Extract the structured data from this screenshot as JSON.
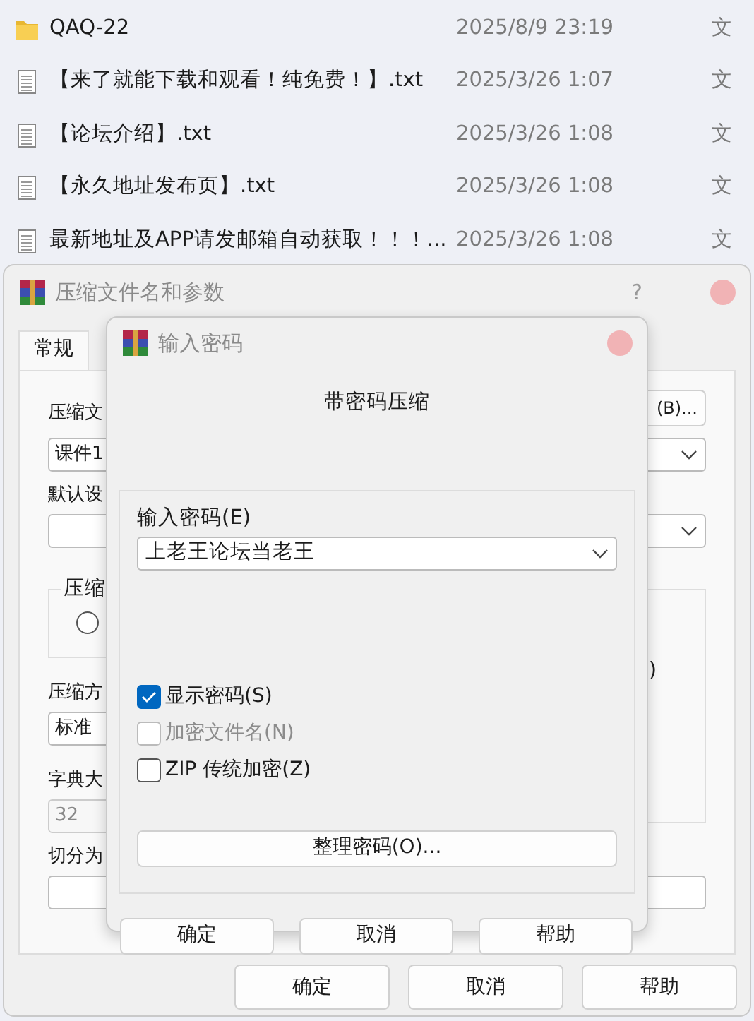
{
  "file_list": [
    {
      "kind": "folder",
      "name": "QAQ-22",
      "modified": "2025/8/9 23:19",
      "type": "文"
    },
    {
      "kind": "text",
      "name": "【来了就能下载和观看！纯免费！】.txt",
      "modified": "2025/3/26 1:07",
      "type": "文"
    },
    {
      "kind": "text",
      "name": "【论坛介绍】.txt",
      "modified": "2025/3/26 1:08",
      "type": "文"
    },
    {
      "kind": "text",
      "name": "【永久地址发布页】.txt",
      "modified": "2025/3/26 1:08",
      "type": "文"
    },
    {
      "kind": "text",
      "name": "最新地址及APP请发邮箱自动获取！！！...",
      "modified": "2025/3/26 1:08",
      "type": "文"
    }
  ],
  "archive_dialog": {
    "title": "压缩文件名和参数",
    "help_glyph": "?",
    "tabs": [
      {
        "label": "常规",
        "selected": true
      }
    ],
    "archive_name_label": "压缩文",
    "browse_button": "(B)...",
    "archive_name_value": "课件1",
    "profile_label": "默认设",
    "compression_group_label": "压缩",
    "radio": {
      "selected": false
    },
    "options_fragment": ")",
    "method_label": "压缩方",
    "method_value": "标准",
    "dictionary_label": "字典大",
    "dictionary_value": "32",
    "split_label": "切分为",
    "buttons": [
      "确定",
      "取消",
      "帮助"
    ]
  },
  "password_dialog": {
    "title": "输入密码",
    "heading": "带密码压缩",
    "password_label": "输入密码(E)",
    "password_value": "上老王论坛当老王",
    "options": [
      {
        "label": "显示密码(S)",
        "checked": true,
        "disabled": false
      },
      {
        "label": "加密文件名(N)",
        "checked": false,
        "disabled": true
      },
      {
        "label": "ZIP 传统加密(Z)",
        "checked": false,
        "disabled": false
      }
    ],
    "organize_button": "整理密码(O)...",
    "buttons": [
      "确定",
      "取消",
      "帮助"
    ]
  }
}
